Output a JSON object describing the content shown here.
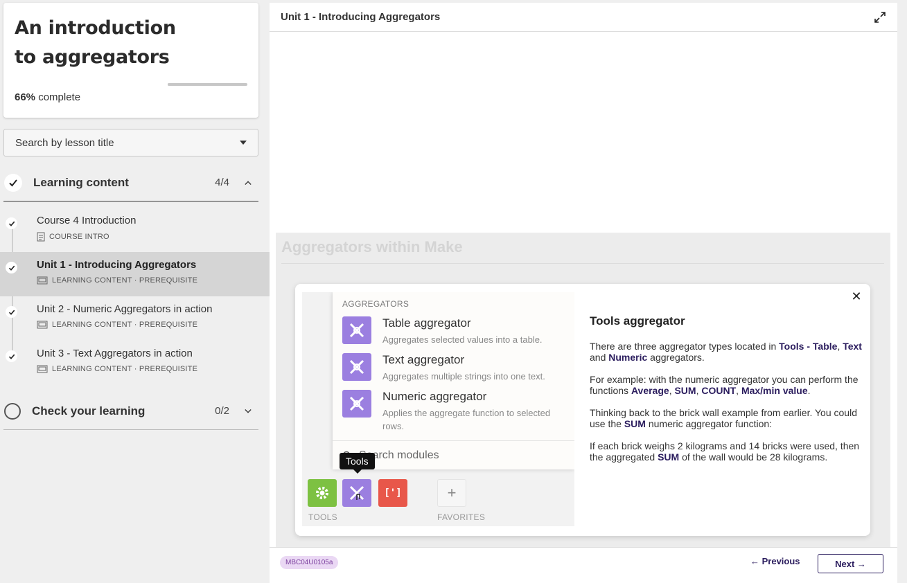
{
  "course": {
    "title": "An introduction to aggregators",
    "progress_percent": 66,
    "progress_label": "66%",
    "complete_label": " complete"
  },
  "search": {
    "placeholder": "Search by lesson title"
  },
  "sections": [
    {
      "label": "Learning content",
      "count": "4/4",
      "status": "complete",
      "expanded": true
    },
    {
      "label": "Check your learning",
      "count": "0/2",
      "status": "incomplete",
      "expanded": false
    }
  ],
  "lessons": [
    {
      "title": "Course 4 Introduction",
      "meta": "COURSE INTRO",
      "active": false
    },
    {
      "title": "Unit 1 - Introducing Aggregators",
      "meta": "LEARNING CONTENT · PREREQUISITE",
      "active": true
    },
    {
      "title": "Unit 2 - Numeric Aggregators in action",
      "meta": "LEARNING CONTENT · PREREQUISITE",
      "active": false
    },
    {
      "title": "Unit 3 - Text Aggregators in action",
      "meta": "LEARNING CONTENT · PREREQUISITE",
      "active": false
    }
  ],
  "main": {
    "title": "Unit 1 - Introducing Aggregators",
    "faded_heading": "Aggregators within Make"
  },
  "screenshot": {
    "heading": "AGGREGATORS",
    "items": [
      {
        "name": "Table aggregator",
        "desc": "Aggregates selected values into a table."
      },
      {
        "name": "Text aggregator",
        "desc": "Aggregates multiple strings into one text."
      },
      {
        "name": "Numeric aggregator",
        "desc": "Applies the aggregate function to selected rows."
      }
    ],
    "search_placeholder": "Search modules",
    "tooltip": "Tools",
    "tools_label": "TOOLS",
    "favorites_label": "FAVORITES",
    "colors": {
      "green": "#7dc142",
      "purple": "#9b7fe0",
      "red": "#e8574a"
    }
  },
  "popup": {
    "title": "Tools aggregator",
    "p1_a": "There are three aggregator types located in ",
    "p1_b": "Tools - Table",
    "p1_c": ", ",
    "p1_d": "Text",
    "p1_e": " and ",
    "p1_f": "Numeric",
    "p1_g": " aggregators.",
    "p2_a": "For example: with the numeric aggregator you can perform the functions ",
    "p2_b": "Average",
    "p2_c": ", ",
    "p2_d": "SUM",
    "p2_e": ", ",
    "p2_f": "COUNT",
    "p2_g": ", ",
    "p2_h": "Max/min value",
    "p2_i": ".",
    "p3_a": "Thinking back to the brick wall example from earlier. You could use the ",
    "p3_b": "SUM",
    "p3_c": " numeric aggregator function:",
    "p4_a": "If each brick weighs 2 kilograms and 14 bricks were used, then the aggregated ",
    "p4_b": "SUM",
    "p4_c": " of the wall would be 28 kilograms.",
    "close": "✕"
  },
  "footer": {
    "code": "MBC04U0105a",
    "previous": "← Previous",
    "next": "Next →"
  }
}
